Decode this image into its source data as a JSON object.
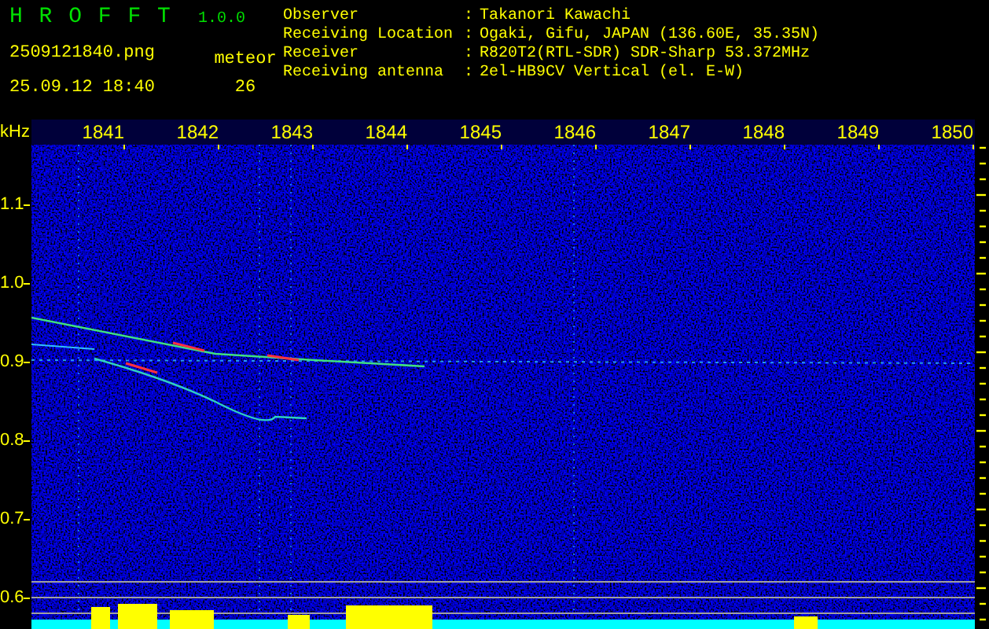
{
  "app": {
    "title": "H R O F F T",
    "version": "1.0.0"
  },
  "file": {
    "name": "2509121840.png",
    "datetime": "25.09.12 18:40"
  },
  "detection": {
    "label": "meteor",
    "count": "26"
  },
  "station": [
    {
      "label": "Observer",
      "separator": ":",
      "value": "Takanori Kawachi"
    },
    {
      "label": "Receiving Location",
      "separator": ":",
      "value": "Ogaki, Gifu, JAPAN (136.60E, 35.35N)"
    },
    {
      "label": "Receiver",
      "separator": ":",
      "value": "R820T2(RTL-SDR) SDR-Sharp 53.372MHz"
    },
    {
      "label": "Receiving antenna",
      "separator": ":",
      "value": "2el-HB9CV Vertical (el. E-W)"
    }
  ],
  "axes": {
    "unit": "kHz",
    "time_labels": [
      "1841",
      "1842",
      "1843",
      "1844",
      "1845",
      "1846",
      "1847",
      "1848",
      "1849",
      "1850"
    ],
    "frequency_labels": [
      "1.1",
      "1.0",
      "0.9",
      "0.8",
      "0.7",
      "0.6"
    ]
  }
}
